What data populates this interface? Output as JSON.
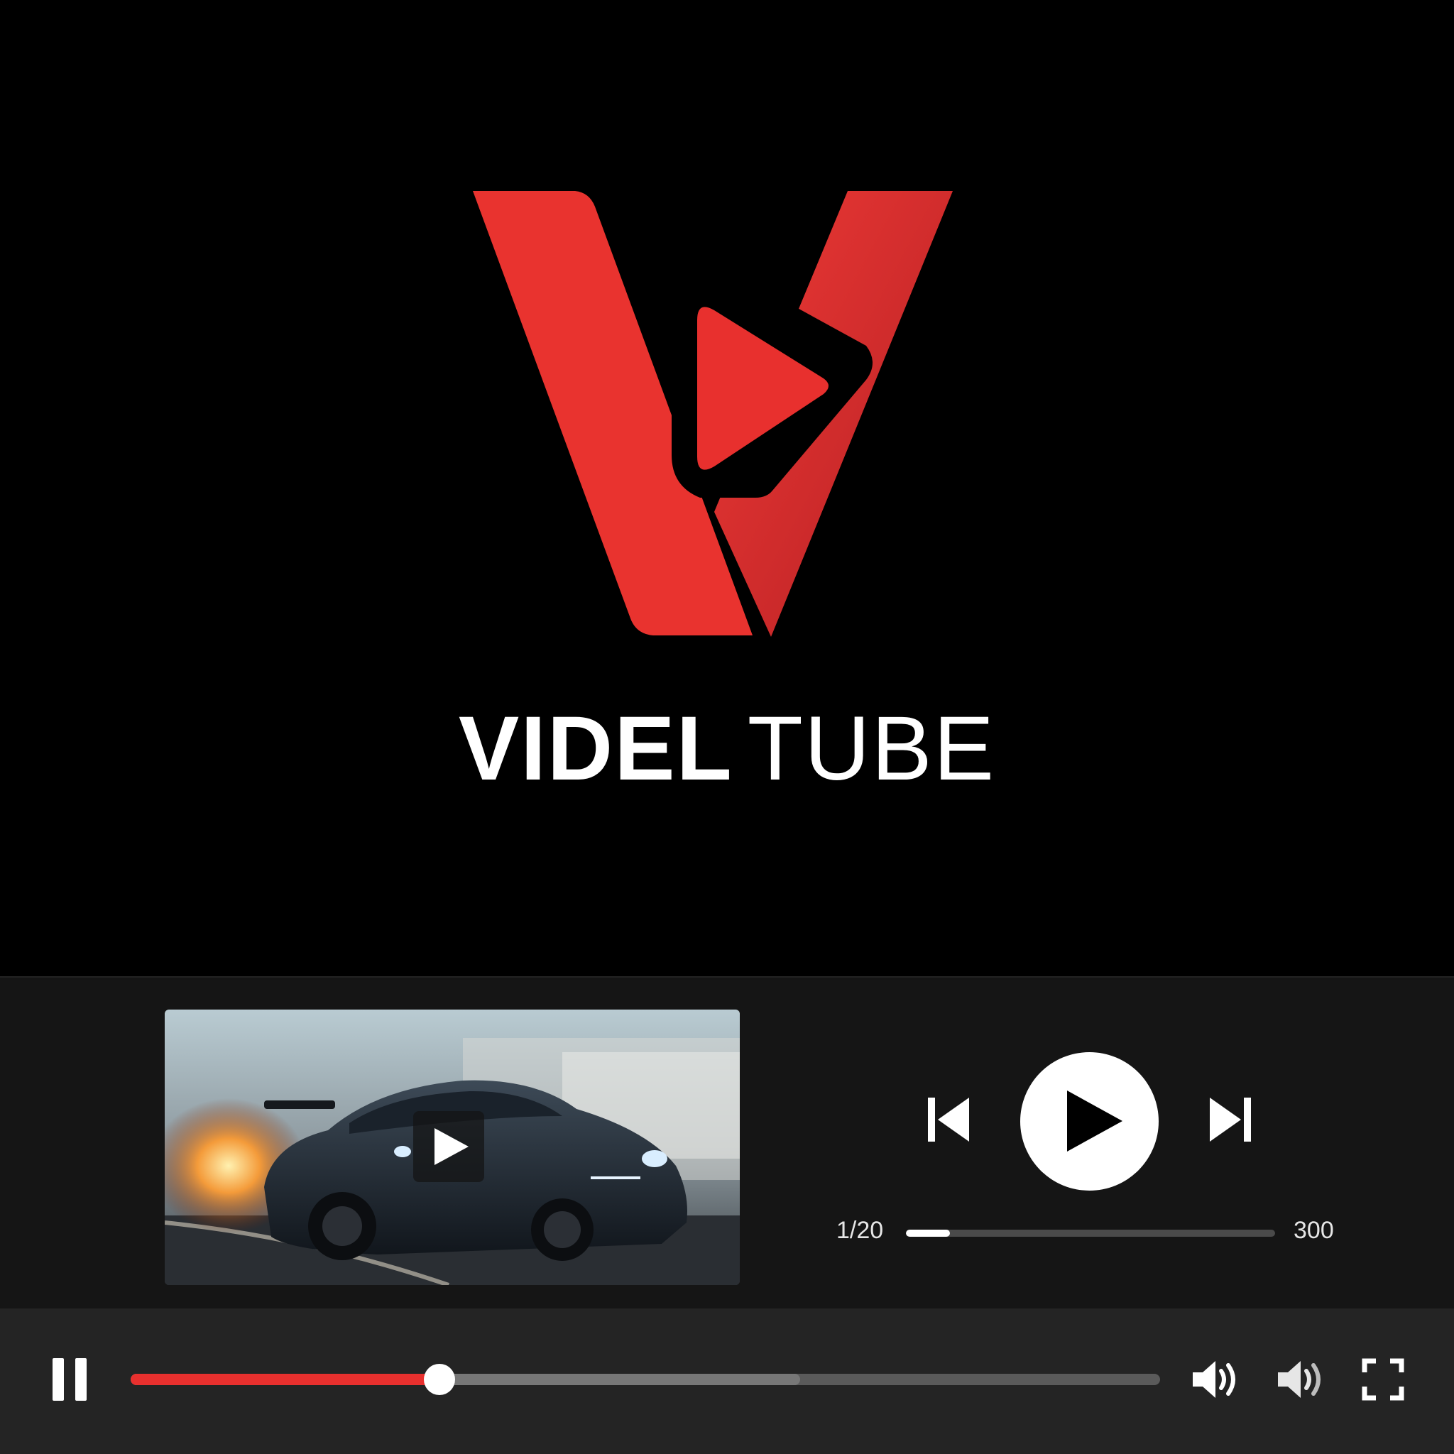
{
  "brand": {
    "name_bold": "VIDEL",
    "name_light": "TUBE",
    "logo": "red-v-play-logo",
    "accent": "#e8302e"
  },
  "preview": {
    "thumbnail": "sports-car-speed-thumbnail",
    "overlay_icon": "play-icon"
  },
  "playlist": {
    "position": "1/20",
    "total": "300",
    "progress_fraction": 0.12,
    "controls": [
      "skip-previous-icon",
      "play-icon",
      "skip-next-icon"
    ]
  },
  "player_bar": {
    "state_icon": "pause-icon",
    "played_fraction": 0.3,
    "buffered_fraction": 0.65,
    "icons": [
      "volume-icon",
      "volume-low-icon",
      "fullscreen-icon"
    ]
  }
}
